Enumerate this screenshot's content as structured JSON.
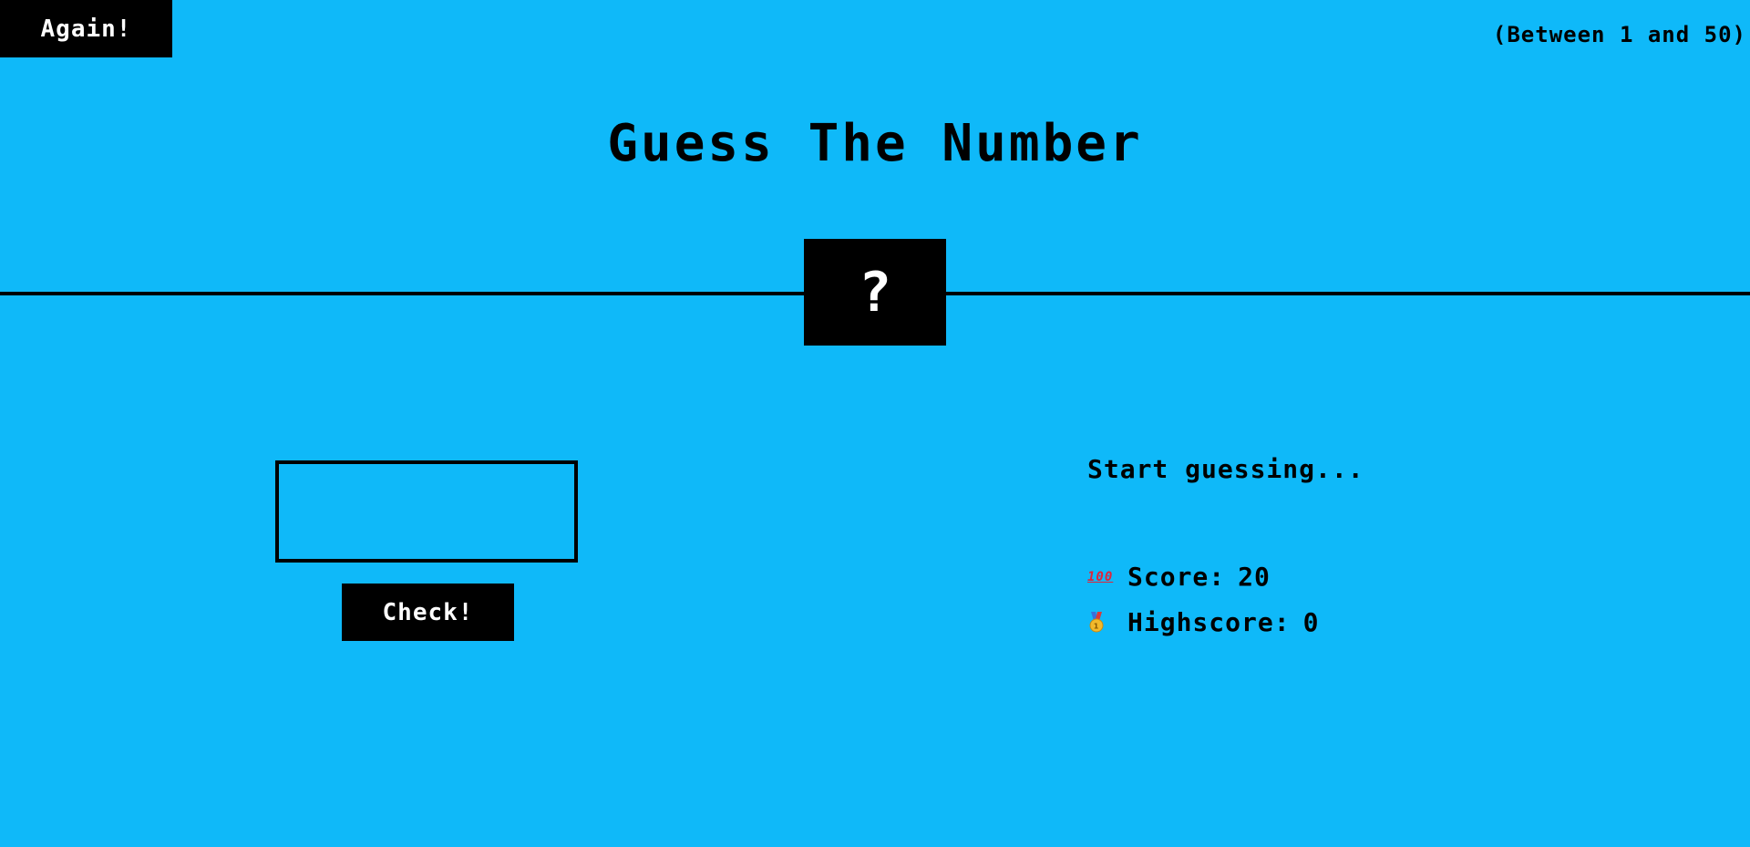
{
  "header": {
    "again_label": "Again!",
    "range_hint": "(Between 1 and 50)"
  },
  "title": "Guess The Number",
  "secret": {
    "display": "?"
  },
  "input": {
    "value": "",
    "placeholder": ""
  },
  "check_label": "Check!",
  "message": "Start guessing...",
  "stats": {
    "score_label": "Score:",
    "score_value": "20",
    "score_icon": "hundred-points-icon",
    "highscore_label": "Highscore:",
    "highscore_value": "0",
    "highscore_icon": "medal-icon"
  },
  "colors": {
    "background": "#0fb9f9",
    "foreground": "#000000",
    "button_text": "#ffffff"
  }
}
